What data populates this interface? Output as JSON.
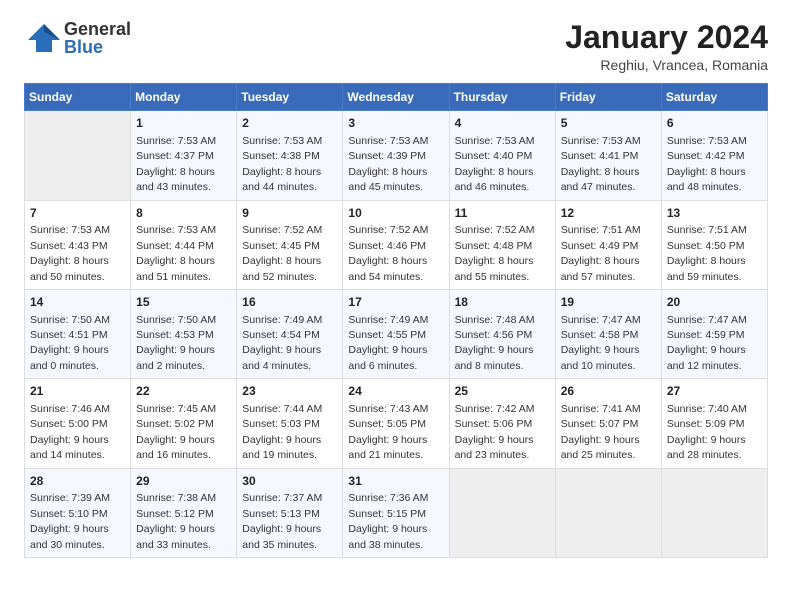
{
  "header": {
    "logo": {
      "general": "General",
      "blue": "Blue"
    },
    "title": "January 2024",
    "location": "Reghiu, Vrancea, Romania"
  },
  "days_of_week": [
    "Sunday",
    "Monday",
    "Tuesday",
    "Wednesday",
    "Thursday",
    "Friday",
    "Saturday"
  ],
  "weeks": [
    [
      {
        "day": null
      },
      {
        "day": 1,
        "sunrise": "7:53 AM",
        "sunset": "4:37 PM",
        "daylight": "8 hours and 43 minutes."
      },
      {
        "day": 2,
        "sunrise": "7:53 AM",
        "sunset": "4:38 PM",
        "daylight": "8 hours and 44 minutes."
      },
      {
        "day": 3,
        "sunrise": "7:53 AM",
        "sunset": "4:39 PM",
        "daylight": "8 hours and 45 minutes."
      },
      {
        "day": 4,
        "sunrise": "7:53 AM",
        "sunset": "4:40 PM",
        "daylight": "8 hours and 46 minutes."
      },
      {
        "day": 5,
        "sunrise": "7:53 AM",
        "sunset": "4:41 PM",
        "daylight": "8 hours and 47 minutes."
      },
      {
        "day": 6,
        "sunrise": "7:53 AM",
        "sunset": "4:42 PM",
        "daylight": "8 hours and 48 minutes."
      }
    ],
    [
      {
        "day": 7,
        "sunrise": "7:53 AM",
        "sunset": "4:43 PM",
        "daylight": "8 hours and 50 minutes."
      },
      {
        "day": 8,
        "sunrise": "7:53 AM",
        "sunset": "4:44 PM",
        "daylight": "8 hours and 51 minutes."
      },
      {
        "day": 9,
        "sunrise": "7:52 AM",
        "sunset": "4:45 PM",
        "daylight": "8 hours and 52 minutes."
      },
      {
        "day": 10,
        "sunrise": "7:52 AM",
        "sunset": "4:46 PM",
        "daylight": "8 hours and 54 minutes."
      },
      {
        "day": 11,
        "sunrise": "7:52 AM",
        "sunset": "4:48 PM",
        "daylight": "8 hours and 55 minutes."
      },
      {
        "day": 12,
        "sunrise": "7:51 AM",
        "sunset": "4:49 PM",
        "daylight": "8 hours and 57 minutes."
      },
      {
        "day": 13,
        "sunrise": "7:51 AM",
        "sunset": "4:50 PM",
        "daylight": "8 hours and 59 minutes."
      }
    ],
    [
      {
        "day": 14,
        "sunrise": "7:50 AM",
        "sunset": "4:51 PM",
        "daylight": "9 hours and 0 minutes."
      },
      {
        "day": 15,
        "sunrise": "7:50 AM",
        "sunset": "4:53 PM",
        "daylight": "9 hours and 2 minutes."
      },
      {
        "day": 16,
        "sunrise": "7:49 AM",
        "sunset": "4:54 PM",
        "daylight": "9 hours and 4 minutes."
      },
      {
        "day": 17,
        "sunrise": "7:49 AM",
        "sunset": "4:55 PM",
        "daylight": "9 hours and 6 minutes."
      },
      {
        "day": 18,
        "sunrise": "7:48 AM",
        "sunset": "4:56 PM",
        "daylight": "9 hours and 8 minutes."
      },
      {
        "day": 19,
        "sunrise": "7:47 AM",
        "sunset": "4:58 PM",
        "daylight": "9 hours and 10 minutes."
      },
      {
        "day": 20,
        "sunrise": "7:47 AM",
        "sunset": "4:59 PM",
        "daylight": "9 hours and 12 minutes."
      }
    ],
    [
      {
        "day": 21,
        "sunrise": "7:46 AM",
        "sunset": "5:00 PM",
        "daylight": "9 hours and 14 minutes."
      },
      {
        "day": 22,
        "sunrise": "7:45 AM",
        "sunset": "5:02 PM",
        "daylight": "9 hours and 16 minutes."
      },
      {
        "day": 23,
        "sunrise": "7:44 AM",
        "sunset": "5:03 PM",
        "daylight": "9 hours and 19 minutes."
      },
      {
        "day": 24,
        "sunrise": "7:43 AM",
        "sunset": "5:05 PM",
        "daylight": "9 hours and 21 minutes."
      },
      {
        "day": 25,
        "sunrise": "7:42 AM",
        "sunset": "5:06 PM",
        "daylight": "9 hours and 23 minutes."
      },
      {
        "day": 26,
        "sunrise": "7:41 AM",
        "sunset": "5:07 PM",
        "daylight": "9 hours and 25 minutes."
      },
      {
        "day": 27,
        "sunrise": "7:40 AM",
        "sunset": "5:09 PM",
        "daylight": "9 hours and 28 minutes."
      }
    ],
    [
      {
        "day": 28,
        "sunrise": "7:39 AM",
        "sunset": "5:10 PM",
        "daylight": "9 hours and 30 minutes."
      },
      {
        "day": 29,
        "sunrise": "7:38 AM",
        "sunset": "5:12 PM",
        "daylight": "9 hours and 33 minutes."
      },
      {
        "day": 30,
        "sunrise": "7:37 AM",
        "sunset": "5:13 PM",
        "daylight": "9 hours and 35 minutes."
      },
      {
        "day": 31,
        "sunrise": "7:36 AM",
        "sunset": "5:15 PM",
        "daylight": "9 hours and 38 minutes."
      },
      {
        "day": null
      },
      {
        "day": null
      },
      {
        "day": null
      }
    ]
  ],
  "labels": {
    "sunrise": "Sunrise:",
    "sunset": "Sunset:",
    "daylight": "Daylight:"
  }
}
